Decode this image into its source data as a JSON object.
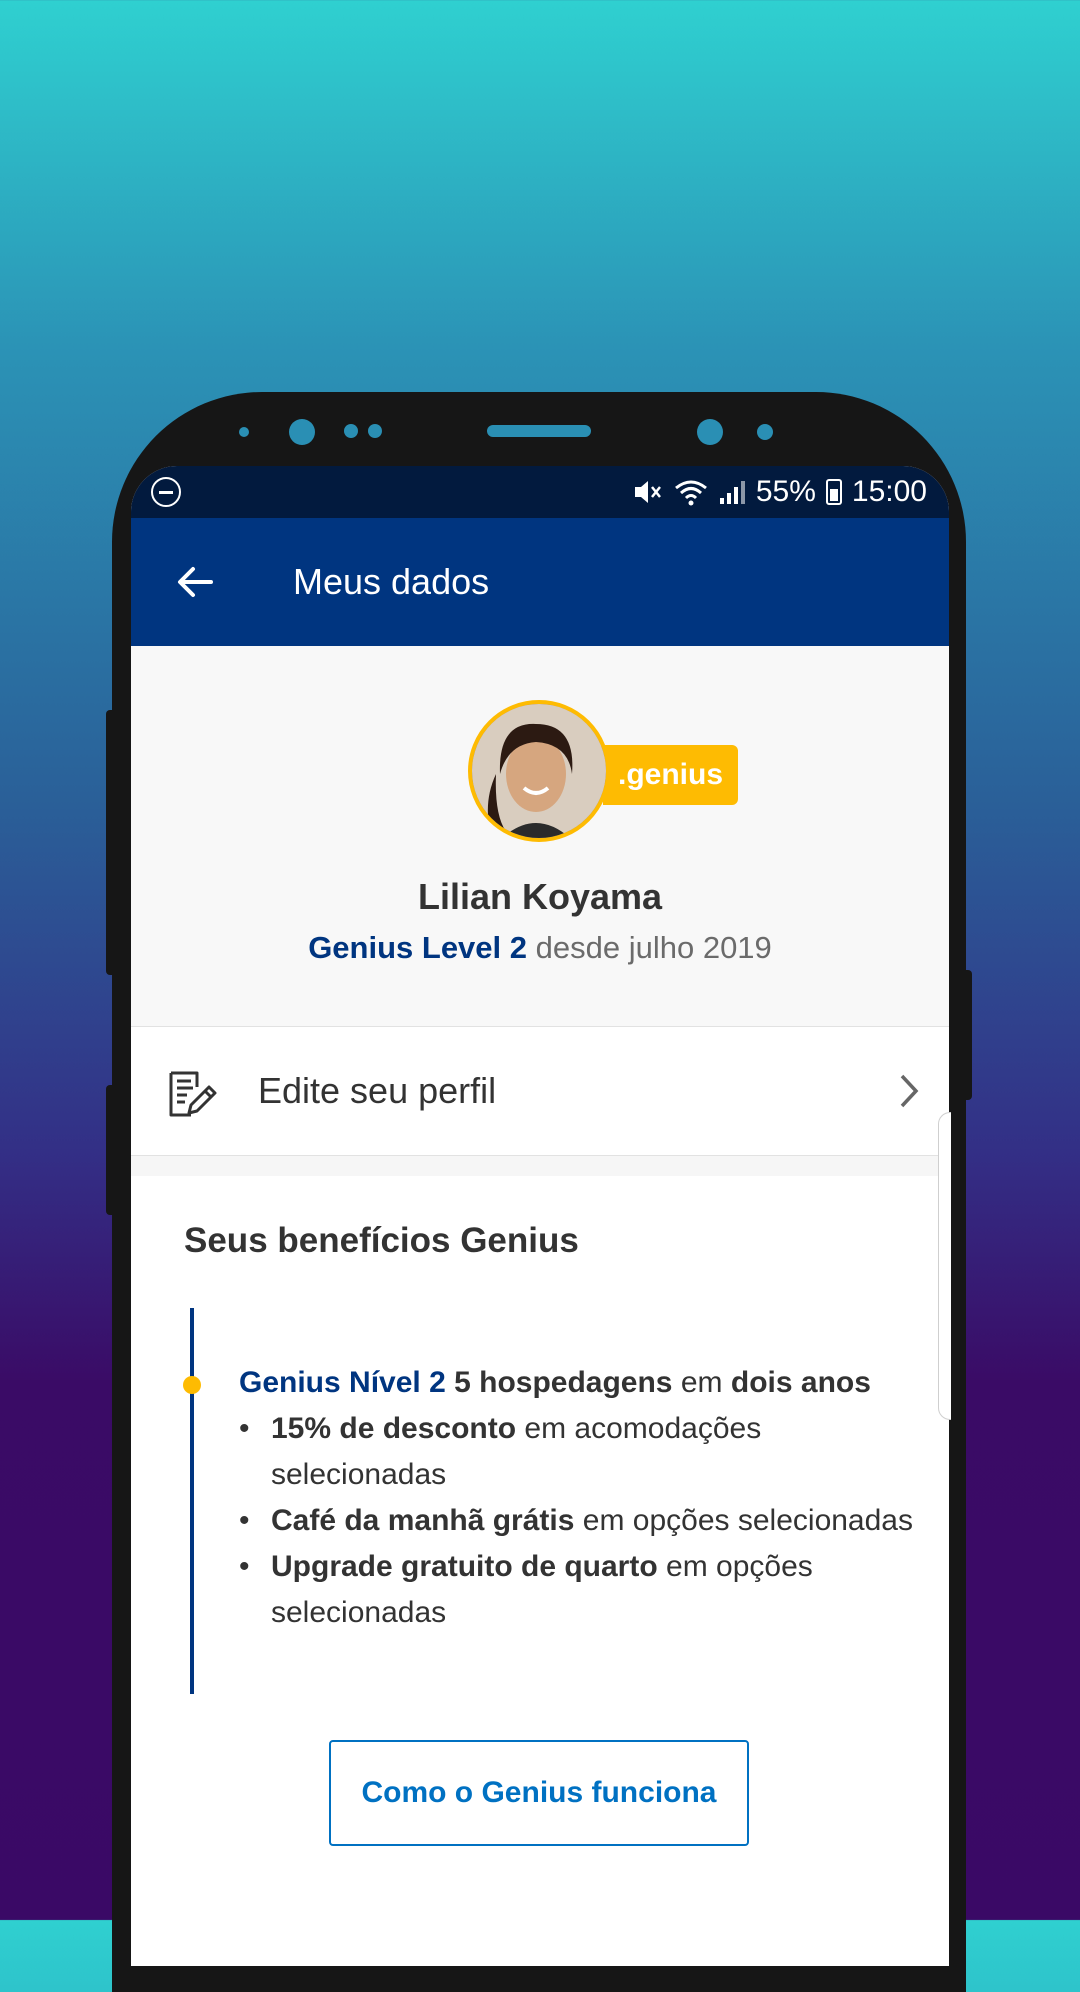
{
  "status_bar": {
    "battery": "55%",
    "time": "15:00",
    "icons": [
      "do-not-disturb-icon",
      "mute-icon",
      "wifi-icon",
      "signal-icon",
      "battery-icon"
    ]
  },
  "app_bar": {
    "title": "Meus dados",
    "back_icon": "arrow-left-icon"
  },
  "profile": {
    "badge": ".genius",
    "name": "Lilian Koyama",
    "level": "Genius Level 2",
    "since": "desde julho 2019"
  },
  "edit_profile": {
    "label": "Edite seu perfil",
    "icon": "edit-document-icon"
  },
  "benefits": {
    "title": "Seus benefícios Genius",
    "level_name": "Genius Nível 2",
    "level_stays": "5 hospedagens",
    "level_in": "em",
    "level_period": "dois anos",
    "items": [
      {
        "bold": "15% de desconto",
        "rest": "em acomodações selecionadas"
      },
      {
        "bold": "Café da manhã grátis",
        "rest": "em opções selecionadas"
      },
      {
        "bold": "Upgrade gratuito de quarto",
        "rest": "em opções selecionadas"
      }
    ],
    "bullet": "•",
    "how_button": "Como o Genius funciona"
  },
  "colors": {
    "brand_blue": "#003580",
    "genius_yellow": "#febb02",
    "link_blue": "#0071c2"
  }
}
